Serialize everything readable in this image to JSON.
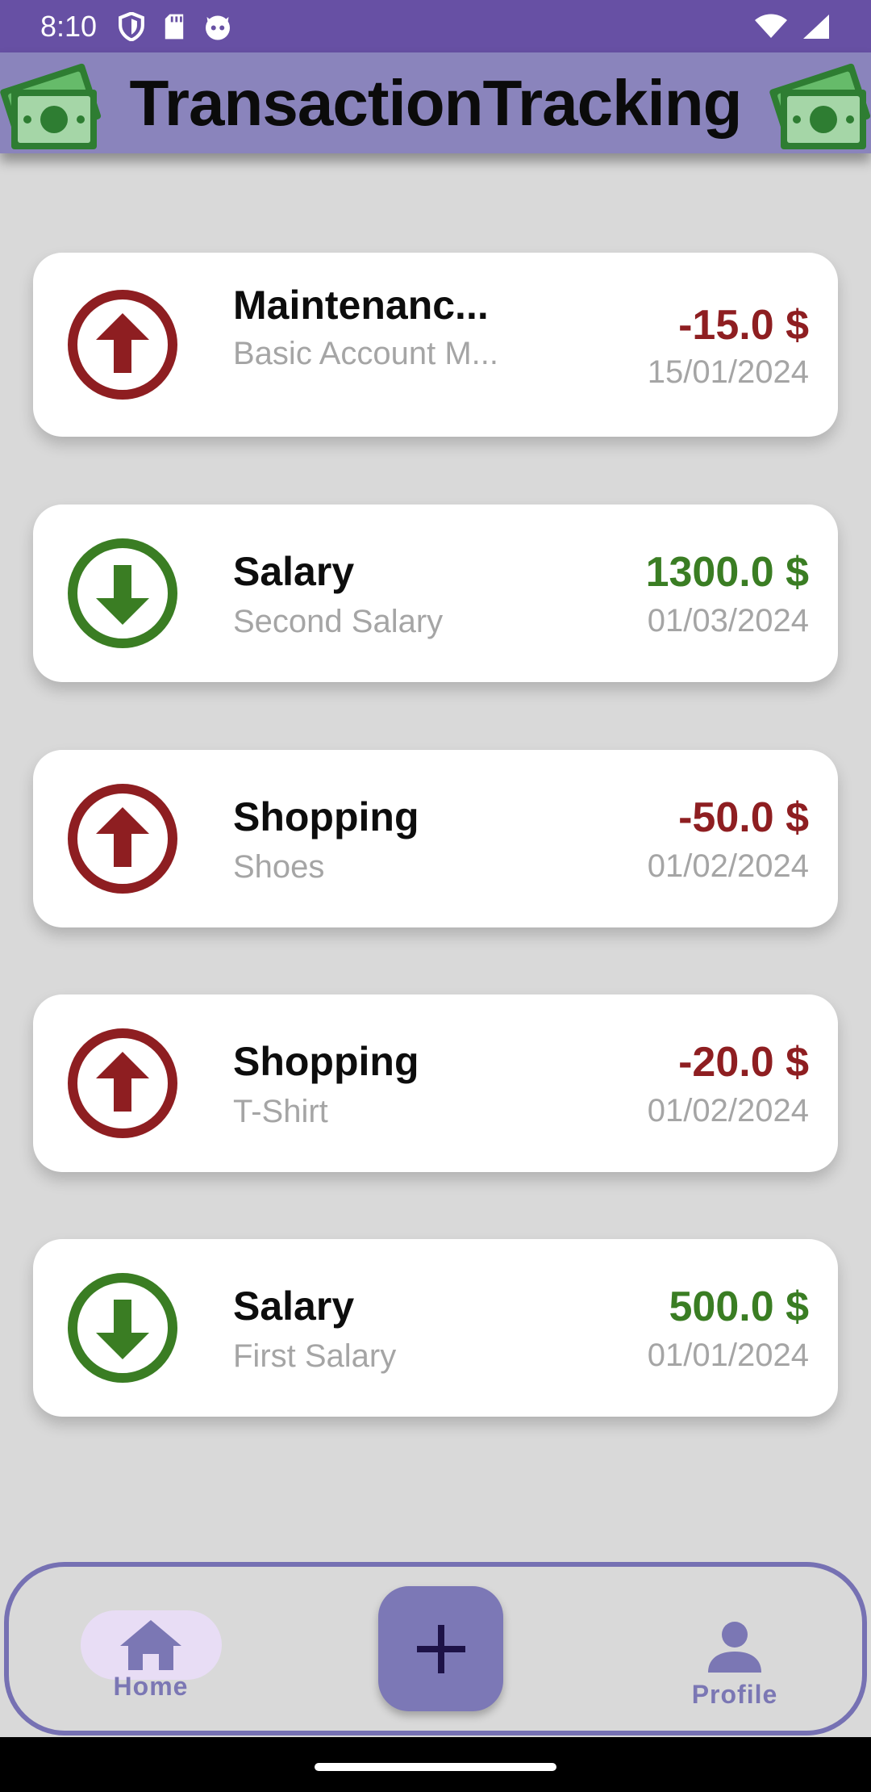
{
  "status_bar": {
    "time": "8:10",
    "icons_left": [
      "shield-icon",
      "sd-card-icon",
      "cat-face-icon"
    ],
    "icons_right": [
      "wifi-icon",
      "signal-icon"
    ]
  },
  "app_bar": {
    "title": "TransactionTracking",
    "icon": "money-bill-icon"
  },
  "colors": {
    "primary": "#6750a4",
    "app_bar": "#8a84bc",
    "expense": "#8e1e21",
    "income": "#3a7d23",
    "background": "#d9d9d9"
  },
  "transactions": [
    {
      "category": "Maintenanc...",
      "description": "Basic Account M...",
      "amount": "-15.0 $",
      "date": "15/01/2024",
      "direction": "up",
      "icon": "arrow-up-circle-icon"
    },
    {
      "category": "Salary",
      "description": "Second Salary",
      "amount": "1300.0 $",
      "date": "01/03/2024",
      "direction": "down",
      "icon": "arrow-down-circle-icon"
    },
    {
      "category": "Shopping",
      "description": "Shoes",
      "amount": "-50.0 $",
      "date": "01/02/2024",
      "direction": "up",
      "icon": "arrow-up-circle-icon"
    },
    {
      "category": "Shopping",
      "description": "T-Shirt",
      "amount": "-20.0 $",
      "date": "01/02/2024",
      "direction": "up",
      "icon": "arrow-up-circle-icon"
    },
    {
      "category": "Salary",
      "description": "First Salary",
      "amount": "500.0 $",
      "date": "01/01/2024",
      "direction": "down",
      "icon": "arrow-down-circle-icon"
    }
  ],
  "bottom_nav": {
    "home_label": "Home",
    "profile_label": "Profile",
    "fab_icon": "plus-icon"
  }
}
